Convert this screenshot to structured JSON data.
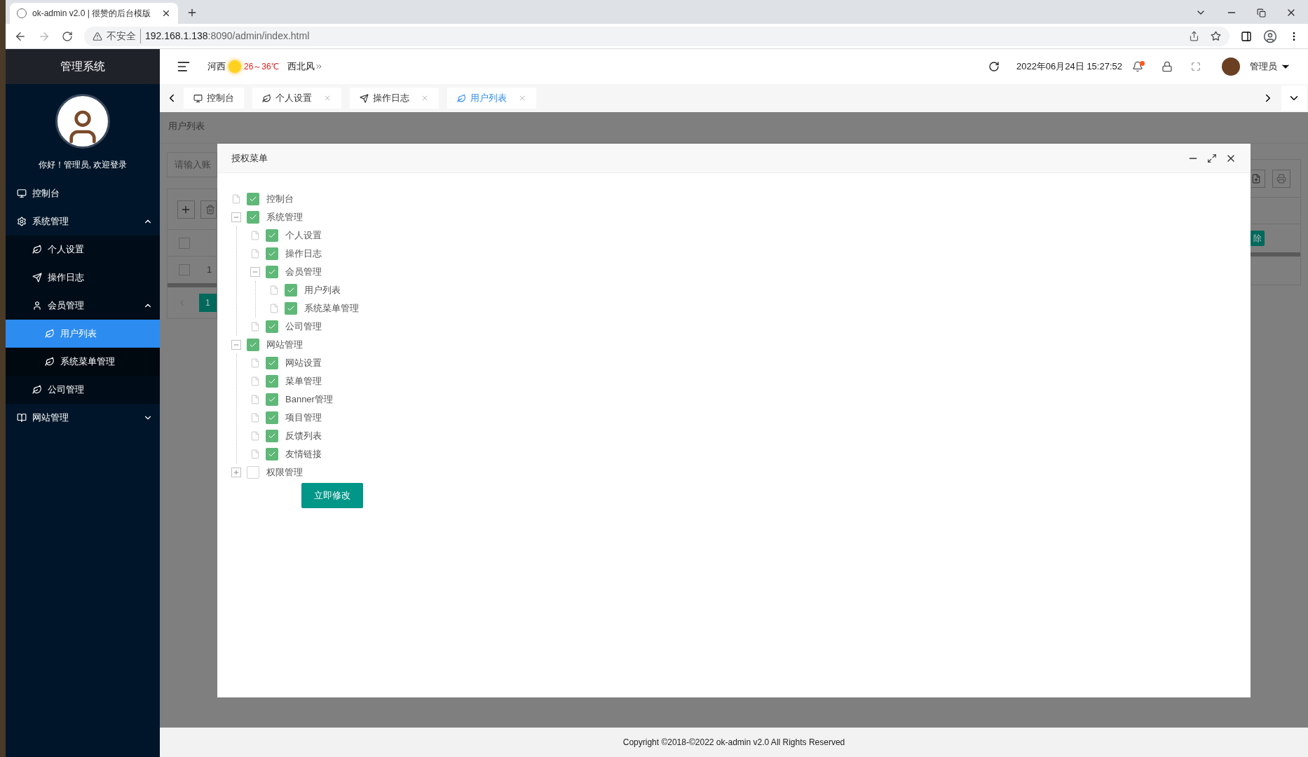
{
  "browser": {
    "tab_title": "ok-admin v2.0 | 很赞的后台模版",
    "security": "不安全",
    "url_host": "192.168.1.138",
    "url_path": ":8090/admin/index.html"
  },
  "sidebar": {
    "title": "管理系统",
    "greeting": "你好！管理员, 欢迎登录",
    "items": [
      {
        "label": "控制台",
        "selected": false
      },
      {
        "label": "系统管理",
        "selected": false,
        "expanded": true,
        "children": [
          {
            "label": "个人设置",
            "selected": false
          },
          {
            "label": "操作日志",
            "selected": false
          },
          {
            "label": "会员管理",
            "selected": false,
            "expanded": true,
            "children": [
              {
                "label": "用户列表",
                "selected": true
              },
              {
                "label": "系统菜单管理",
                "selected": false
              }
            ]
          },
          {
            "label": "公司管理",
            "selected": false
          }
        ]
      },
      {
        "label": "网站管理",
        "selected": false,
        "expanded": false
      }
    ]
  },
  "header": {
    "city": "河西",
    "temperature": "26～36℃",
    "wind": "西北风",
    "datetime": "2022年06月24日 15:27:52",
    "user": "管理员"
  },
  "tabs": [
    {
      "label": "控制台",
      "selected": false,
      "closable": false
    },
    {
      "label": "个人设置",
      "selected": false,
      "closable": true
    },
    {
      "label": "操作日志",
      "selected": false,
      "closable": true
    },
    {
      "label": "用户列表",
      "selected": true,
      "closable": true
    }
  ],
  "page": {
    "breadcrumb": "用户列表",
    "search_placeholder": "请输入账",
    "header_checked": false,
    "row_checked": false,
    "row_number": "1",
    "pagination_page": "1",
    "delete_button": "除"
  },
  "dialog": {
    "title": "授权菜单",
    "submit": "立即修改",
    "tree": [
      {
        "label": "控制台",
        "checked": true
      },
      {
        "label": "系统管理",
        "checked": true,
        "expanded": true,
        "children": [
          {
            "label": "个人设置",
            "checked": true
          },
          {
            "label": "操作日志",
            "checked": true
          },
          {
            "label": "会员管理",
            "checked": true,
            "expanded": true,
            "children": [
              {
                "label": "用户列表",
                "checked": true
              },
              {
                "label": "系统菜单管理",
                "checked": true
              }
            ]
          },
          {
            "label": "公司管理",
            "checked": true
          }
        ]
      },
      {
        "label": "网站管理",
        "checked": true,
        "expanded": true,
        "children": [
          {
            "label": "网站设置",
            "checked": true
          },
          {
            "label": "菜单管理",
            "checked": true
          },
          {
            "label": "Banner管理",
            "checked": true
          },
          {
            "label": "项目管理",
            "checked": true
          },
          {
            "label": "反馈列表",
            "checked": true
          },
          {
            "label": "友情链接",
            "checked": true
          }
        ]
      },
      {
        "label": "权限管理",
        "checked": false,
        "expanded": false
      }
    ]
  },
  "footer": "Copyright ©2018-©2022 ok-admin v2.0 All Rights Reserved"
}
